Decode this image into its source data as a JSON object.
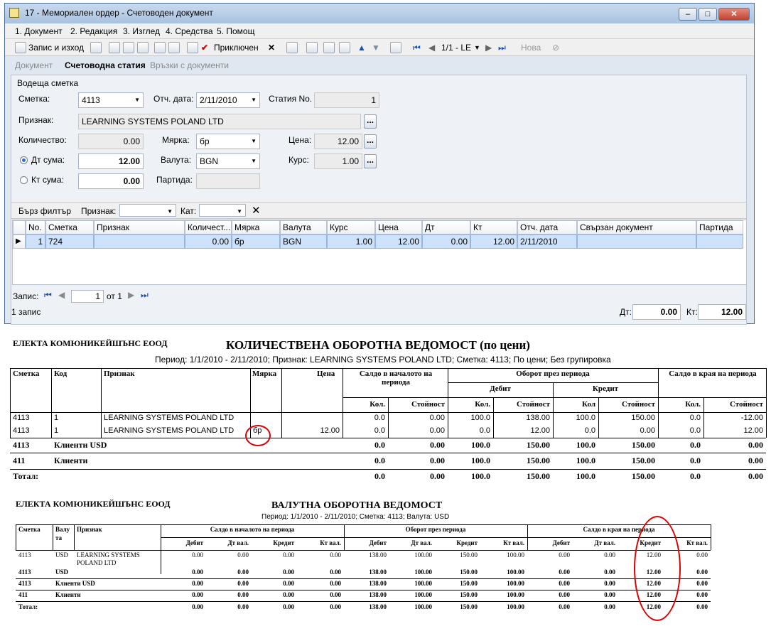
{
  "window": {
    "title": "17 - Мемориален ордер - Счетоводен документ",
    "menu": [
      "1. Документ",
      "2. Редакция",
      "3. Изглед",
      "4. Средства",
      "5. Помощ"
    ],
    "toolbar": {
      "save_exit": "Запис и изход",
      "posted": "Приключен",
      "record_nav": "1/1 - LE",
      "new": "Нова"
    },
    "tabs": [
      "Документ",
      "Счетоводна статия",
      "Връзки с документи"
    ],
    "form": {
      "section": "Водеща сметка",
      "account_label": "Сметка:",
      "account_value": "4113",
      "report_date_label": "Отч. дата:",
      "report_date_value": "2/11/2010",
      "article_no_label": "Статия No.",
      "article_no_value": "1",
      "attr_label": "Признак:",
      "attr_value": "LEARNING SYSTEMS POLAND LTD",
      "qty_label": "Количество:",
      "qty_value": "0.00",
      "unit_label": "Мярка:",
      "unit_value": "бр",
      "price_label": "Цена:",
      "price_value": "12.00",
      "dt_label": "Дт сума:",
      "dt_value": "12.00",
      "currency_label": "Валута:",
      "currency_value": "BGN",
      "rate_label": "Курс:",
      "rate_value": "1.00",
      "kt_label": "Кт сума:",
      "kt_value": "0.00",
      "batch_label": "Партида:"
    },
    "filter": {
      "quick": "Бърз филтър",
      "attr": "Признак:",
      "cat": "Кат:"
    },
    "grid": {
      "headers": [
        "No.",
        "Сметка",
        "Признак",
        "Количест...",
        "Мярка",
        "Валута",
        "Курс",
        "Цена",
        "Дт",
        "Кт",
        "Отч. дата",
        "Свързан документ",
        "Партида"
      ],
      "row": [
        "1",
        "724",
        "",
        "0.00",
        "бр",
        "BGN",
        "1.00",
        "12.00",
        "0.00",
        "12.00",
        "2/11/2010",
        "",
        ""
      ]
    },
    "footer": {
      "record_label": "Запис:",
      "record_no": "1",
      "of_label": "от 1",
      "count": "1 запис",
      "dt_label": "Дт:",
      "dt_total": "0.00",
      "kt_label": "Кт:",
      "kt_total": "12.00"
    }
  },
  "report1": {
    "company": "ЕЛЕКТА КОМЮНИКЕЙШЪНС ЕООД",
    "title": "КОЛИЧЕСТВЕНА ОБОРОТНА ВЕДОМОСТ (по цени)",
    "subtitle": "Период: 1/1/2010 - 2/11/2010; Признак: LEARNING SYSTEMS POLAND LTD; Сметка: 4113; По цени; Без групировка",
    "h": {
      "account": "Сметка",
      "code": "Код",
      "attr": "Признак",
      "unit": "Мярка",
      "price": "Цена",
      "opening": "Салдо в началото на периода",
      "turnover": "Оборот през периода",
      "debit": "Дебит",
      "credit": "Кредит",
      "closing": "Салдо в края на периода",
      "qty": "Кол.",
      "qty2": "Кол",
      "value": "Стойност"
    },
    "rows": [
      [
        "4113",
        "1",
        "LEARNING SYSTEMS POLAND LTD",
        "",
        "",
        "0.0",
        "0.00",
        "100.0",
        "138.00",
        "100.0",
        "150.00",
        "0.0",
        "-12.00"
      ],
      [
        "4113",
        "1",
        "LEARNING SYSTEMS POLAND LTD",
        "бр",
        "12.00",
        "0.0",
        "0.00",
        "0.0",
        "12.00",
        "0.0",
        "0.00",
        "0.0",
        "12.00"
      ]
    ],
    "totals": [
      [
        "4113",
        "Клиенти USD",
        "0.0",
        "0.00",
        "100.0",
        "150.00",
        "100.0",
        "150.00",
        "0.0",
        "0.00"
      ],
      [
        "411",
        "Клиенти",
        "0.0",
        "0.00",
        "100.0",
        "150.00",
        "100.0",
        "150.00",
        "0.0",
        "0.00"
      ],
      [
        "Тотал:",
        "",
        "0.0",
        "0.00",
        "100.0",
        "150.00",
        "100.0",
        "150.00",
        "0.0",
        "0.00"
      ]
    ]
  },
  "report2": {
    "company": "ЕЛЕКТА КОМЮНИКЕЙШЪНС ЕООД",
    "title": "ВАЛУТНА ОБОРОТНА ВЕДОМОСТ",
    "subtitle": "Период: 1/1/2010 - 2/11/2010; Сметка: 4113; Валута: USD",
    "h": {
      "account": "Сметка",
      "currency1": "Валу",
      "currency2": "та",
      "attr": "Признак",
      "opening": "Салдо в началото на периода",
      "turnover": "Оборот през периода",
      "closing": "Салдо в края на периода",
      "debit": "Дебит",
      "dtcur": "Дт вал.",
      "credit": "Кредит",
      "ktcur": "Кт вал."
    },
    "row": {
      "account": "4113",
      "currency": "USD",
      "attr1": "LEARNING SYSTEMS",
      "attr2": "POLAND LTD",
      "values": [
        "0.00",
        "0.00",
        "0.00",
        "0.00",
        "138.00",
        "100.00",
        "150.00",
        "100.00",
        "0.00",
        "0.00",
        "12.00",
        "0.00"
      ]
    },
    "subtotals": [
      [
        "4113",
        "USD",
        "0.00",
        "0.00",
        "0.00",
        "0.00",
        "138.00",
        "100.00",
        "150.00",
        "100.00",
        "0.00",
        "0.00",
        "12.00",
        "0.00"
      ],
      [
        "4113",
        "Клиенти USD",
        "0.00",
        "0.00",
        "0.00",
        "0.00",
        "138.00",
        "100.00",
        "150.00",
        "100.00",
        "0.00",
        "0.00",
        "12.00",
        "0.00"
      ],
      [
        "411",
        "Клиенти",
        "0.00",
        "0.00",
        "0.00",
        "0.00",
        "138.00",
        "100.00",
        "150.00",
        "100.00",
        "0.00",
        "0.00",
        "12.00",
        "0.00"
      ],
      [
        "Тотал:",
        "",
        "0.00",
        "0.00",
        "0.00",
        "0.00",
        "138.00",
        "100.00",
        "150.00",
        "100.00",
        "0.00",
        "0.00",
        "12.00",
        "0.00"
      ]
    ]
  }
}
